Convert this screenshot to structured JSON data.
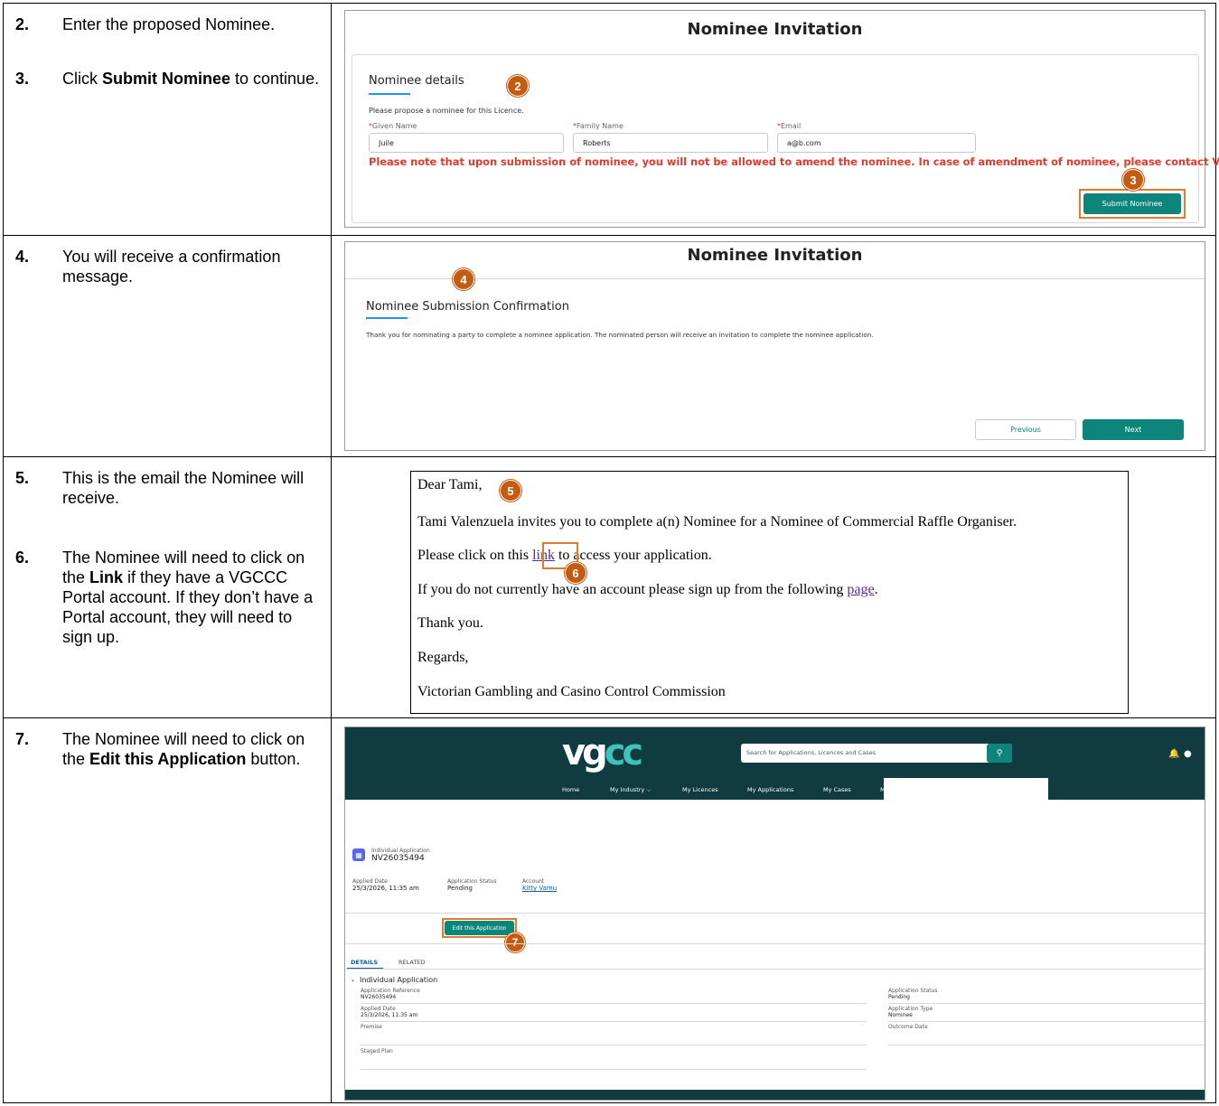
{
  "rows": [
    {
      "steps": [
        {
          "num": "2.",
          "text": "Enter the proposed Nominee."
        },
        {
          "num": "3.",
          "text_before": "Click ",
          "bold": "Submit Nominee",
          "text_after": " to continue."
        }
      ]
    },
    {
      "steps": [
        {
          "num": "4.",
          "text": "You will receive a confirmation message."
        }
      ]
    },
    {
      "steps": [
        {
          "num": "5.",
          "text": "This is the email the Nominee will receive."
        },
        {
          "num": "6.",
          "text_before": "The Nominee will need to click on the ",
          "bold": "Link",
          "text_after": " if they have a VGCCC Portal account. If they don’t have a Portal account, they will need to sign up."
        }
      ]
    },
    {
      "steps": [
        {
          "num": "7.",
          "text_before": "The Nominee will need to click on the ",
          "bold": "Edit this Application",
          "text_after": " button."
        }
      ]
    }
  ],
  "shot1": {
    "title": "Nominee Invitation",
    "section": "Nominee details",
    "helper": "Please propose a nominee for this Licence.",
    "given_label": "Given Name",
    "family_label": "Family Name",
    "email_label": "Email",
    "req_mark": "*",
    "given_value": "Juile",
    "family_value": "Roberts",
    "email_value": "a@b.com",
    "warning": "Please note that upon submission of nominee, you will not be allowed to amend the nominee. In case of amendment of nominee, please contact VGCCC.",
    "submit_label": "Submit Nominee",
    "badge_a": "2",
    "badge_b": "3"
  },
  "shot2": {
    "title": "Nominee Invitation",
    "section": "Nominee Submission Confirmation",
    "message": "Thank you for nominating a party to complete a nominee application. The nominated person will receive an invitation to complete the nominee application.",
    "previous_label": "Previous",
    "next_label": "Next",
    "badge": "4"
  },
  "email": {
    "greeting": "Dear Tami,",
    "invite": "Tami Valenzuela invites you to complete a(n) Nominee for a Nominee of Commercial Raffle Organiser.",
    "click_before": "Please click on this ",
    "link_text": "link",
    "click_after": " to access your application.",
    "signup_before": "If you do not currently have an account please sign up from the following ",
    "page_text": "page",
    "signup_after": ".",
    "thanks": "Thank you.",
    "regards": "Regards,",
    "org": "Victorian Gambling and Casino Control Commission",
    "badge_a": "5",
    "badge_b": "6"
  },
  "portal": {
    "logo_left": "vg",
    "logo_right": "cc",
    "search_placeholder": "Search for Applications, Licences and Cases",
    "nav": [
      "Home",
      "My Industry ⌵",
      "My Licences",
      "My Applications",
      "My Cases",
      "M"
    ],
    "record_type": "Individual Application",
    "record_id": "NV26035494",
    "applied_label": "Applied Date",
    "applied_value": "25/3/2026, 11:35 am",
    "status_label": "Application Status",
    "status_value": "Pending",
    "account_label": "Account",
    "account_value": "Kitty Vamu",
    "edit_label": "Edit this Application",
    "tab_details": "DETAILS",
    "tab_related": "RELATED",
    "section": "Individual Application",
    "ref_label": "Application Reference",
    "ref_value": "NV26035494",
    "applied2_label": "Applied Date",
    "applied2_value": "25/3/2026, 11:35 am",
    "premise_label": "Premise",
    "staged_label": "Staged Plan",
    "status2_label": "Application Status",
    "status2_value": "Pending",
    "type_label": "Application Type",
    "type_value": "Nominee",
    "outcome_label": "Outcome Date",
    "badge": "7"
  }
}
